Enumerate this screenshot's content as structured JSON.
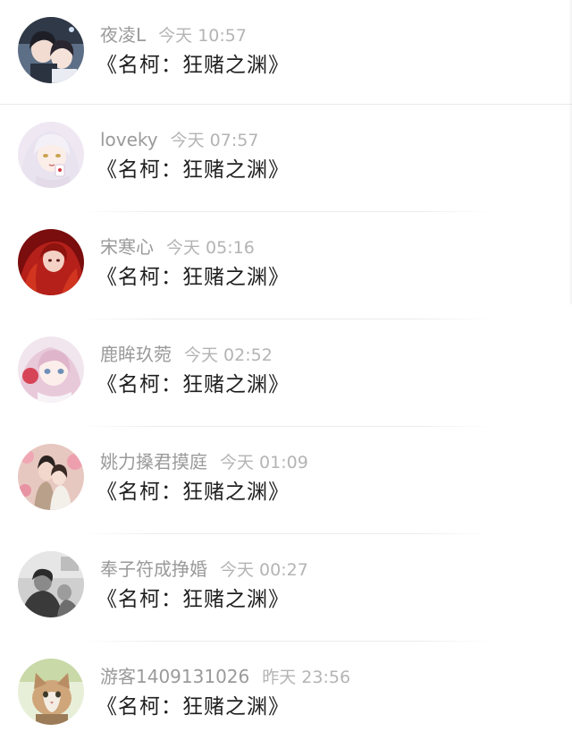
{
  "comments": [
    {
      "name": "夜凌L",
      "time": "今天 10:57",
      "text": "《名柯：狂赌之渊》",
      "avatar": "anime-couple-avatar-icon"
    },
    {
      "name": "loveky",
      "time": "今天 07:57",
      "text": "《名柯：狂赌之渊》",
      "avatar": "white-haired-girl-avatar-icon"
    },
    {
      "name": "宋寒心",
      "time": "今天 05:16",
      "text": "《名柯：狂赌之渊》",
      "avatar": "red-haired-girl-avatar-icon"
    },
    {
      "name": "鹿眸玖菀",
      "time": "今天 02:52",
      "text": "《名柯：狂赌之渊》",
      "avatar": "pink-haired-girl-avatar-icon"
    },
    {
      "name": "姚力搡君摸庭",
      "time": "今天 01:09",
      "text": "《名柯：狂赌之渊》",
      "avatar": "ancient-costume-couple-avatar-icon"
    },
    {
      "name": "奉子符成挣婚",
      "time": "今天 00:27",
      "text": "《名柯：狂赌之渊》",
      "avatar": "grayscale-couple-avatar-icon"
    },
    {
      "name": "游客1409131026",
      "time": "昨天 23:56",
      "text": "《名柯：狂赌之渊》",
      "avatar": "cat-avatar-icon"
    }
  ],
  "colors": {
    "name_text": "#9a9a9a",
    "time_text": "#b4b4b4",
    "message_text": "#1f1f1f",
    "divider": "#ececec",
    "background": "#ffffff"
  }
}
